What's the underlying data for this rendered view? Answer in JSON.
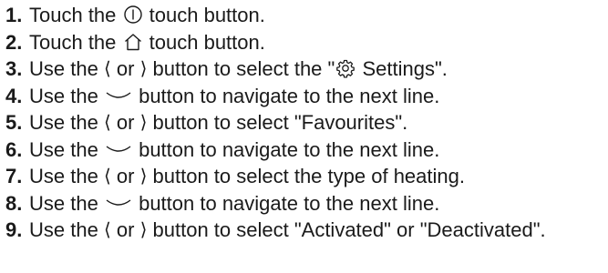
{
  "steps": [
    {
      "number": "1.",
      "before": "Touch the",
      "icon": "power-icon",
      "after": "touch button."
    },
    {
      "number": "2.",
      "before": "Touch the",
      "icon": "home-icon",
      "after": "touch button."
    },
    {
      "number": "3.",
      "before": "Use the",
      "left_glyph": "⟨",
      "middle": "or",
      "right_glyph": "⟩",
      "after_a": "button to select the \"",
      "icon": "gear-icon",
      "after_b": "Settings\"."
    },
    {
      "number": "4.",
      "before": "Use the",
      "icon": "chevron-down-icon",
      "after": "button to navigate to the next line."
    },
    {
      "number": "5.",
      "before": "Use the",
      "left_glyph": "⟨",
      "middle": "or",
      "right_glyph": "⟩",
      "after": "button to select \"Favourites\"."
    },
    {
      "number": "6.",
      "before": "Use the",
      "icon": "chevron-down-icon",
      "after": "button to navigate to the next line."
    },
    {
      "number": "7.",
      "before": "Use the",
      "left_glyph": "⟨",
      "middle": "or",
      "right_glyph": "⟩",
      "after": "button to select the type of heating."
    },
    {
      "number": "8.",
      "before": "Use the",
      "icon": "chevron-down-icon",
      "after": "button to navigate to the next line."
    },
    {
      "number": "9.",
      "before": "Use the",
      "left_glyph": "⟨",
      "middle": "or",
      "right_glyph": "⟩",
      "after": "button to select \"Activated\" or \"Deactivated\"."
    }
  ]
}
